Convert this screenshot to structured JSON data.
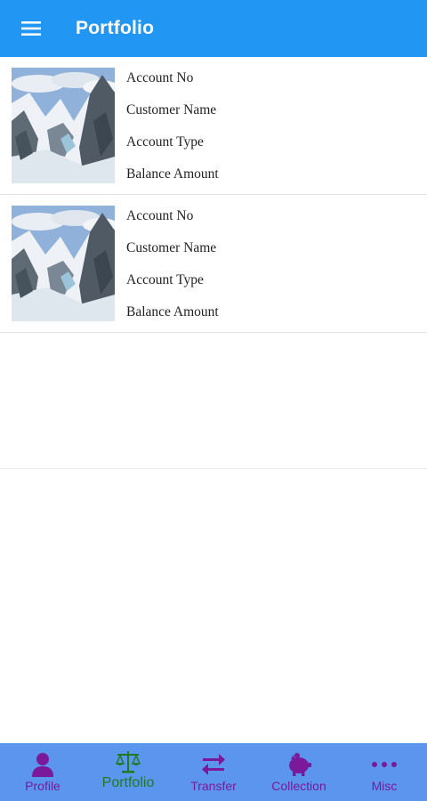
{
  "header": {
    "title": "Portfolio",
    "menu_icon": "menu-icon"
  },
  "accounts": [
    {
      "image": "mountain-thumbnail",
      "account_no": "Account No",
      "customer_name": "Customer Name",
      "account_type": "Account Type",
      "balance_amount": "Balance Amount"
    },
    {
      "image": "mountain-thumbnail",
      "account_no": "Account No",
      "customer_name": "Customer Name",
      "account_type": "Account Type",
      "balance_amount": "Balance Amount"
    }
  ],
  "bottom_nav": {
    "items": [
      {
        "label": "Profile",
        "icon": "person-icon",
        "active": false
      },
      {
        "label": "Portfolio",
        "icon": "balance-scale-icon",
        "active": true
      },
      {
        "label": "Transfer",
        "icon": "transfer-arrows-icon",
        "active": false
      },
      {
        "label": "Collection",
        "icon": "piggy-bank-icon",
        "active": false
      },
      {
        "label": "Misc",
        "icon": "more-dots-icon",
        "active": false
      }
    ]
  },
  "colors": {
    "app_bar": "#2196f3",
    "bottom_nav": "#5c95ee",
    "nav_inactive": "#7a1a9a",
    "nav_active": "#1f7a1f"
  }
}
